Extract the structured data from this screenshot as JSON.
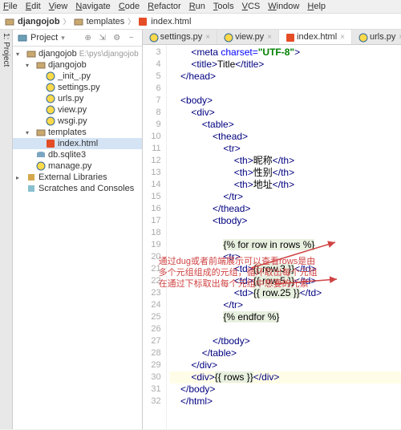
{
  "menu": [
    "File",
    "Edit",
    "View",
    "Navigate",
    "Code",
    "Refactor",
    "Run",
    "Tools",
    "VCS",
    "Window",
    "Help"
  ],
  "breadcrumb": {
    "root": "djangojob",
    "mid": "templates",
    "file": "index.html"
  },
  "panel": {
    "title": "Project",
    "items": [
      {
        "lvl": 0,
        "exp": "▾",
        "name": "djangojob",
        "path": "E:\\pys\\djangojob",
        "kind": "folder"
      },
      {
        "lvl": 1,
        "exp": "▾",
        "name": "djangojob",
        "kind": "folder"
      },
      {
        "lvl": 2,
        "exp": "",
        "name": "_init_.py",
        "kind": "py"
      },
      {
        "lvl": 2,
        "exp": "",
        "name": "settings.py",
        "kind": "py"
      },
      {
        "lvl": 2,
        "exp": "",
        "name": "urls.py",
        "kind": "py"
      },
      {
        "lvl": 2,
        "exp": "",
        "name": "view.py",
        "kind": "py"
      },
      {
        "lvl": 2,
        "exp": "",
        "name": "wsgi.py",
        "kind": "py"
      },
      {
        "lvl": 1,
        "exp": "▾",
        "name": "templates",
        "kind": "folder"
      },
      {
        "lvl": 2,
        "exp": "",
        "name": "index.html",
        "kind": "html",
        "selected": true
      },
      {
        "lvl": 1,
        "exp": "",
        "name": "db.sqlite3",
        "kind": "db"
      },
      {
        "lvl": 1,
        "exp": "",
        "name": "manage.py",
        "kind": "py"
      },
      {
        "lvl": 0,
        "exp": "▸",
        "name": "External Libraries",
        "kind": "lib"
      },
      {
        "lvl": 0,
        "exp": "",
        "name": "Scratches and Consoles",
        "kind": "scratch"
      }
    ]
  },
  "tabs": [
    {
      "label": "settings.py",
      "kind": "py",
      "active": false
    },
    {
      "label": "view.py",
      "kind": "py",
      "active": false
    },
    {
      "label": "index.html",
      "kind": "html",
      "active": true
    },
    {
      "label": "urls.py",
      "kind": "py",
      "active": false
    }
  ],
  "code": {
    "start": 3,
    "lines": [
      {
        "n": 3,
        "i": 8,
        "h": "<span class='tag'>&lt;meta </span><span class='attr'>charset=</span><span class='val'>\"UTF-8\"</span><span class='tag'>&gt;</span>"
      },
      {
        "n": 4,
        "i": 8,
        "h": "<span class='tag'>&lt;title&gt;</span><span class='txt'>Title</span><span class='tag'>&lt;/title&gt;</span>"
      },
      {
        "n": 5,
        "i": 4,
        "h": "<span class='tag'>&lt;/head&gt;</span>"
      },
      {
        "n": 6,
        "i": 0,
        "h": ""
      },
      {
        "n": 7,
        "i": 4,
        "h": "<span class='tag'>&lt;body&gt;</span>"
      },
      {
        "n": 8,
        "i": 8,
        "h": "<span class='tag'>&lt;div&gt;</span>"
      },
      {
        "n": 9,
        "i": 12,
        "h": "<span class='tag'>&lt;table&gt;</span>"
      },
      {
        "n": 10,
        "i": 16,
        "h": "<span class='tag'>&lt;thead&gt;</span>"
      },
      {
        "n": 11,
        "i": 20,
        "h": "<span class='tag'>&lt;tr&gt;</span>"
      },
      {
        "n": 12,
        "i": 24,
        "h": "<span class='tag'>&lt;th&gt;</span><span class='txt'>昵称</span><span class='tag'>&lt;/th&gt;</span>"
      },
      {
        "n": 13,
        "i": 24,
        "h": "<span class='tag'>&lt;th&gt;</span><span class='txt'>性别</span><span class='tag'>&lt;/th&gt;</span>"
      },
      {
        "n": 14,
        "i": 24,
        "h": "<span class='tag'>&lt;th&gt;</span><span class='txt'>地址</span><span class='tag'>&lt;/th&gt;</span>"
      },
      {
        "n": 15,
        "i": 20,
        "h": "<span class='tag'>&lt;/tr&gt;</span>"
      },
      {
        "n": 16,
        "i": 16,
        "h": "<span class='tag'>&lt;/thead&gt;</span>"
      },
      {
        "n": 17,
        "i": 16,
        "h": "<span class='tag'>&lt;tbody&gt;</span>"
      },
      {
        "n": 18,
        "i": 0,
        "h": ""
      },
      {
        "n": 19,
        "i": 20,
        "h": "<span class='tmpl'>{% for row in rows %}</span>"
      },
      {
        "n": 20,
        "i": 20,
        "h": "<span class='tag'>&lt;tr&gt;</span>"
      },
      {
        "n": 21,
        "i": 24,
        "h": "<span class='tag'>&lt;td&gt;</span><span class='tmpl'>{{ row.3 }}</span><span class='tag'>&lt;/td&gt;</span>"
      },
      {
        "n": 22,
        "i": 24,
        "h": "<span class='tag'>&lt;td&gt;</span><span class='tmpl'>{{ row.5 }}</span><span class='tag'>&lt;/td&gt;</span>"
      },
      {
        "n": 23,
        "i": 24,
        "h": "<span class='tag'>&lt;td&gt;</span><span class='tmpl'>{{ row.25 }}</span><span class='tag'>&lt;/td&gt;</span>"
      },
      {
        "n": 24,
        "i": 20,
        "h": "<span class='tag'>&lt;/tr&gt;</span>"
      },
      {
        "n": 25,
        "i": 20,
        "h": "<span class='tmpl'>{% endfor %}</span>"
      },
      {
        "n": 26,
        "i": 0,
        "h": ""
      },
      {
        "n": 27,
        "i": 16,
        "h": "<span class='tag'>&lt;/tbody&gt;</span>"
      },
      {
        "n": 28,
        "i": 12,
        "h": "<span class='tag'>&lt;/table&gt;</span>"
      },
      {
        "n": 29,
        "i": 8,
        "h": "<span class='tag'>&lt;/div&gt;</span>"
      },
      {
        "n": 30,
        "i": 8,
        "h": "<span class='tag'>&lt;div&gt;</span><span class='tmpl'>{{ rows }}</span><span class='tag'>&lt;/div&gt;</span>",
        "hl": true
      },
      {
        "n": 31,
        "i": 4,
        "h": "<span class='tag'>&lt;/body&gt;</span>"
      },
      {
        "n": 32,
        "i": 4,
        "h": "<span class='tag'>&lt;/html&gt;</span>"
      }
    ]
  },
  "annotation": {
    "line1": "通过dug或者前端展示可以查看rows是由",
    "line2": "多个元组组成的元组，循环取出每个元组",
    "line3": "在通过下标取出每个元组中想要的元素"
  },
  "sidebarText": "1: Project"
}
